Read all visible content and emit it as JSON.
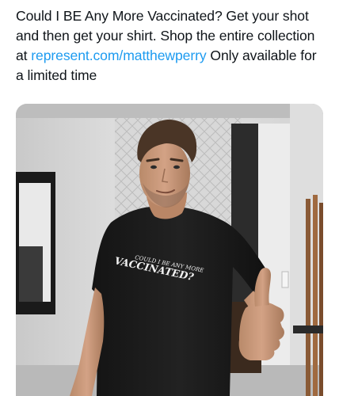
{
  "tweet": {
    "text_before_link": "Could I BE Any More Vaccinated? Get your shot and then get your shirt. Shop the entire collection at ",
    "link_text": "represent.com/matthewperry",
    "text_after_link": " Only available for a limited time"
  },
  "media": {
    "shirt_line_1": "COULD I BE ANY MORE",
    "shirt_line_2": "VACCINATED?"
  }
}
